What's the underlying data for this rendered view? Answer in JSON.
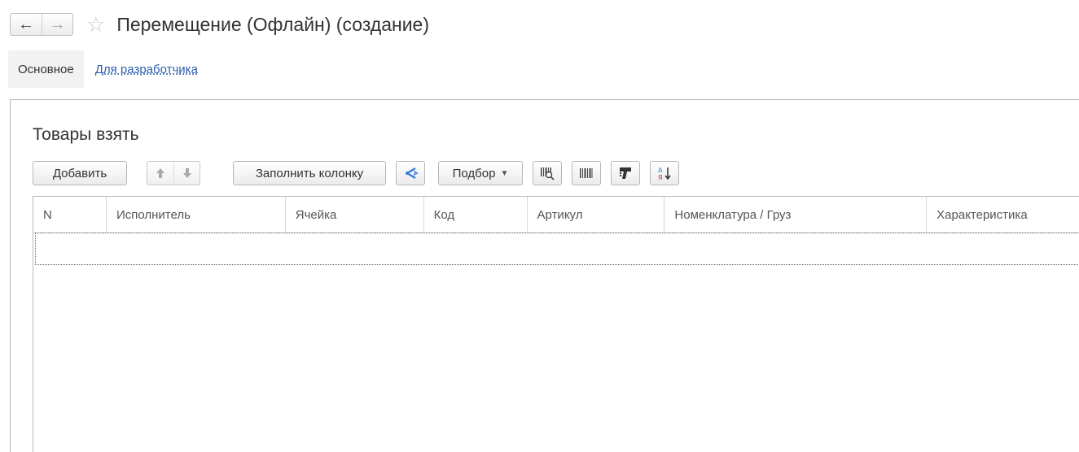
{
  "window": {
    "title": "Перемещение (Офлайн) (создание)",
    "back_icon": "arrow-left",
    "forward_icon": "arrow-right",
    "favorite_icon": "star-outline"
  },
  "tabs": [
    {
      "label": "Основное"
    },
    {
      "label": "Для разработчика"
    }
  ],
  "section": {
    "title": "Товары взять"
  },
  "toolbar": {
    "add_label": "Добавить",
    "fill_column_label": "Заполнить колонку",
    "selection_label": "Подбор",
    "icons": [
      "arrow-up",
      "arrow-down",
      "share-icon",
      "barcode-search-icon",
      "barcode-icon",
      "scanner-icon",
      "sort-alpha-icon"
    ]
  },
  "table": {
    "columns": [
      "N",
      "Исполнитель",
      "Ячейка",
      "Код",
      "Артикул",
      "Номенклатура / Груз",
      "Характеристика"
    ],
    "rows": []
  },
  "colors": {
    "link": "#2d5fb0",
    "accent_blue": "#3a7bd5"
  }
}
